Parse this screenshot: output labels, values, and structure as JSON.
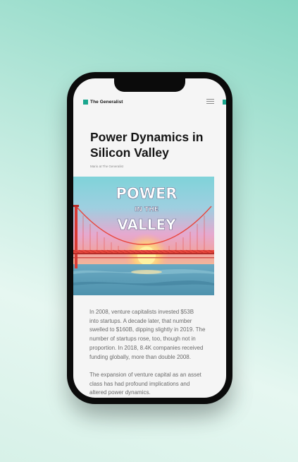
{
  "brand": {
    "name": "The Generalist",
    "accent_color": "#1aa68e",
    "menu_icon": "hamburger-menu-icon"
  },
  "article": {
    "title_line1": "Power Dynamics in",
    "title_line2": "Silicon Valley",
    "byline": "Mario at The Generalist",
    "hero": {
      "line1": "POWER",
      "line2": "IN THE",
      "line3": "VALLEY"
    },
    "paragraphs": [
      {
        "lines": [
          "In 2008, venture capitalists invested $53B",
          "into startups. A decade later, that number",
          "swelled to $160B, dipping slightly in 2019. The",
          "number of startups rose, too, though not in",
          "proportion. In 2018, 8.4K companies received",
          "funding globally, more than double 2008."
        ]
      },
      {
        "lines": [
          "The expansion of venture capital as an asset",
          "class has had profound implications and",
          "altered power dynamics."
        ]
      }
    ]
  }
}
